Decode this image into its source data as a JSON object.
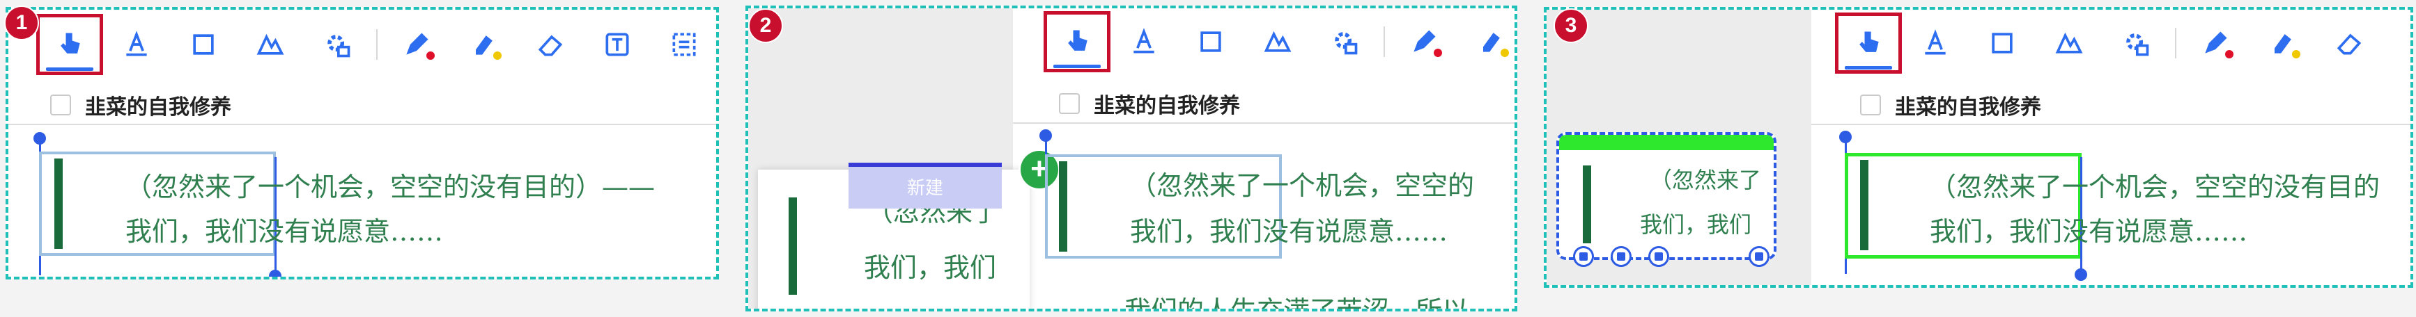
{
  "steps": [
    "1",
    "2",
    "3"
  ],
  "toolbar": {
    "tools": [
      "pointer-tool",
      "text-color-tool",
      "rectangle-tool",
      "shape-tool",
      "settings-tool",
      "pen-tool",
      "highlighter-tool",
      "eraser-tool",
      "text-box-tool",
      "list-tool"
    ],
    "pen_dot_color": "#e0102a",
    "highlighter_dot_color": "#f0c800"
  },
  "tab": {
    "title": "韭菜的自我修养"
  },
  "document": {
    "line1": "（忽然来了一个机会，空空的没有目的）——",
    "line2": "我们，我们没有说愿意……",
    "line3": "我们的人生充满了苦涩，所以"
  },
  "panel2": {
    "new_label": "新建",
    "card_line1": "（忽然来了",
    "card_line2": "我们，我们",
    "doc_line1": "（忽然来了一个机会，空空的",
    "doc_line2": "我们，我们没有说愿意……",
    "doc_line3": "我们的人生充满了苦涩，所以"
  },
  "panel3": {
    "mini_line1": "（忽然来了",
    "mini_line2": "我们，我们",
    "doc_line1": "（忽然来了一个机会，空空的没有目的",
    "doc_line2": "我们，我们没有说愿意……"
  },
  "colors": {
    "accent": "#2d6df0",
    "highlight": "#c8102e",
    "frame": "#1fc0b8",
    "selection_green": "#2ee82e"
  }
}
